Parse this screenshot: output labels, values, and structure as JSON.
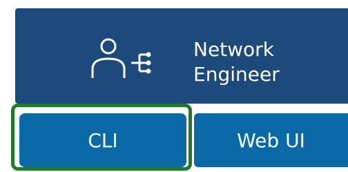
{
  "role": {
    "line1": "Network",
    "line2": "Engineer",
    "icon": "network-engineer-icon"
  },
  "tabs": [
    {
      "label": "CLI",
      "selected": true
    },
    {
      "label": "Web UI",
      "selected": false
    }
  ],
  "colors": {
    "card_bg": "#1d4a7d",
    "tab_bg": "#0a6aa8",
    "selection": "#217a2b"
  }
}
